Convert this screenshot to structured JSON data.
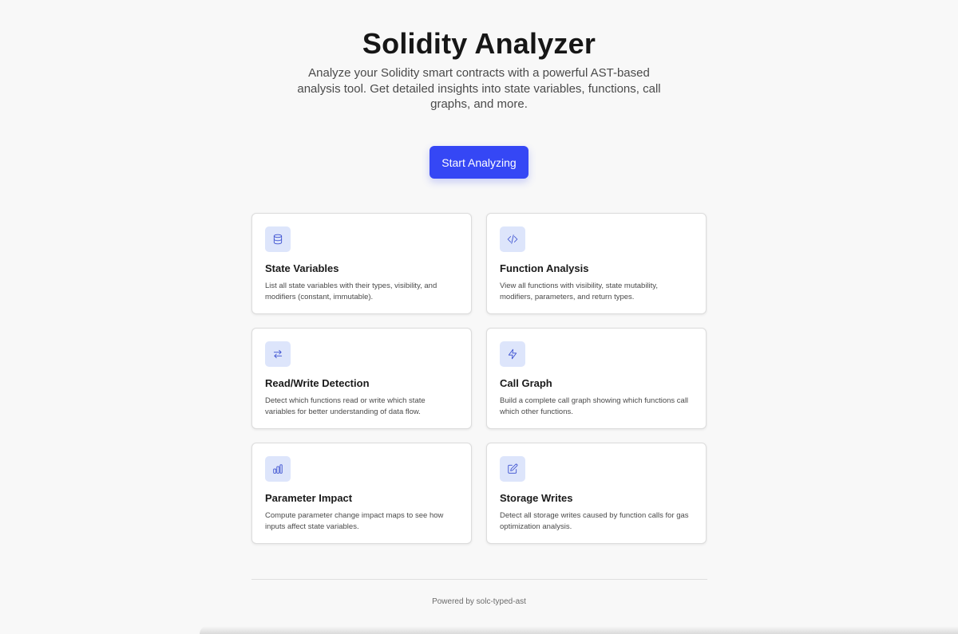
{
  "hero": {
    "title": "Solidity Analyzer",
    "subtitle": "Analyze your Solidity smart contracts with a powerful AST-based analysis tool. Get detailed insights into state variables, functions, call graphs, and more.",
    "cta_label": "Start Analyzing"
  },
  "features": [
    {
      "icon": "database-icon",
      "title": "State Variables",
      "description": "List all state variables with their types, visibility, and modifiers (constant, immutable)."
    },
    {
      "icon": "code-icon",
      "title": "Function Analysis",
      "description": "View all functions with visibility, state mutability, modifiers, parameters, and return types."
    },
    {
      "icon": "arrows-swap-icon",
      "title": "Read/Write Detection",
      "description": "Detect which functions read or write which state variables for better understanding of data flow."
    },
    {
      "icon": "lightning-icon",
      "title": "Call Graph",
      "description": "Build a complete call graph showing which functions call which other functions."
    },
    {
      "icon": "bar-chart-icon",
      "title": "Parameter Impact",
      "description": "Compute parameter change impact maps to see how inputs affect state variables."
    },
    {
      "icon": "edit-icon",
      "title": "Storage Writes",
      "description": "Detect all storage writes caused by function calls for gas optimization analysis."
    }
  ],
  "footer": {
    "text": "Powered by solc-typed-ast"
  },
  "colors": {
    "accent": "#3547f5",
    "icon_bg": "#dde5fb",
    "icon_stroke": "#3a4fd0",
    "page_bg": "#f8f8f8"
  }
}
